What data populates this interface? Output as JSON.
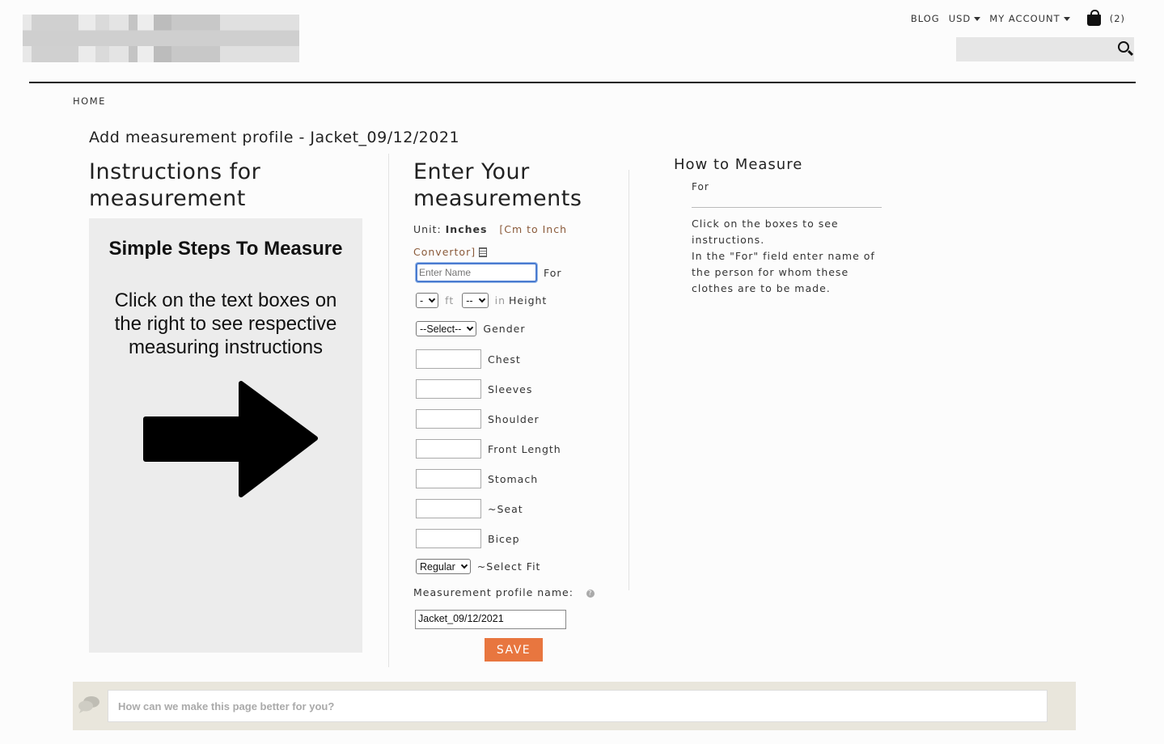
{
  "header": {
    "logo_colors": [
      "#e8e8e8",
      "#d0d0d0",
      "#ebebeb",
      "#dadada",
      "#e4e4e4",
      "#c4c4c4",
      "#ededed",
      "#bcbcbc",
      "#c8c8c8",
      "#e0e0e0"
    ],
    "nav": {
      "blog": "BLOG",
      "currency": "USD",
      "account": "MY ACCOUNT",
      "cart_count": "(2)"
    },
    "breadcrumb": "HOME"
  },
  "page_title": "Add measurement profile - Jacket_09/12/2021",
  "left": {
    "heading": "Instructions for measurement",
    "panel_heading": "Simple Steps To Measure",
    "panel_text": "Click on the text boxes on the right to see respective measuring instructions"
  },
  "middle": {
    "heading": "Enter Your measurements",
    "unit_prefix": "Unit: ",
    "unit_value": "Inches",
    "converter": "[Cm to Inch Convertor]",
    "name_placeholder": "Enter Name",
    "for_label": "For",
    "height": {
      "ft_value": "-",
      "ft_label": "ft",
      "in_value": "--",
      "in_label": "in",
      "label": "Height"
    },
    "gender": {
      "value": "--Select--",
      "label": "Gender"
    },
    "fields": [
      "Chest",
      "Sleeves",
      "Shoulder",
      "Front Length",
      "Stomach",
      "~Seat",
      "Bicep"
    ],
    "fit": {
      "value": "Regular",
      "label": "~Select Fit"
    },
    "profile_name_label": "Measurement profile name:",
    "profile_name_value": "Jacket_09/12/2021",
    "save_label": "SAVE"
  },
  "right": {
    "heading": "How to Measure",
    "for_label": "For",
    "instructions": [
      "Click on the boxes to see instructions.",
      "In the \"For\" field enter name of the person for whom these clothes are to be made."
    ]
  },
  "feedback": {
    "placeholder": "How can we make this page better for you?"
  },
  "colors": {
    "accent": "#e8763f",
    "feedback_bg": "#e9e6dc",
    "panel_bg": "#ececec"
  }
}
